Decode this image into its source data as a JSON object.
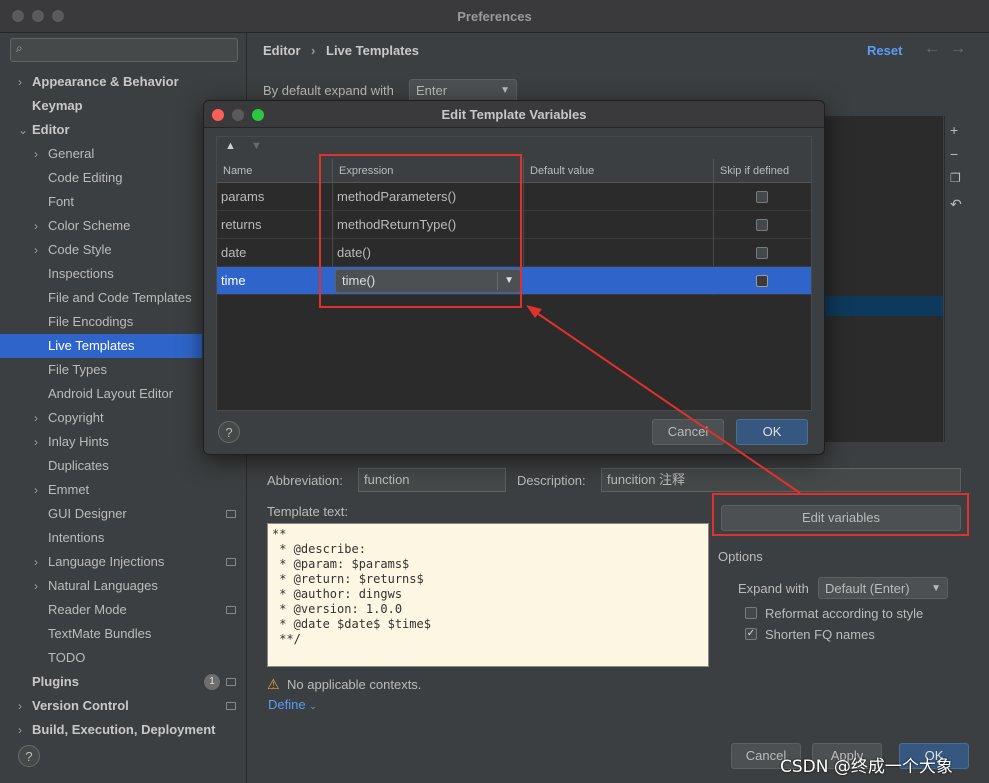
{
  "window": {
    "title": "Preferences"
  },
  "search": {
    "placeholder": ""
  },
  "sidebar": {
    "items": [
      {
        "label": "Appearance & Behavior",
        "arrow": "›",
        "bold": true
      },
      {
        "label": "Keymap",
        "arrow": "",
        "bold": true
      },
      {
        "label": "Editor",
        "arrow": "⌄",
        "bold": true
      },
      {
        "label": "General",
        "arrow": "›"
      },
      {
        "label": "Code Editing",
        "arrow": ""
      },
      {
        "label": "Font",
        "arrow": ""
      },
      {
        "label": "Color Scheme",
        "arrow": "›"
      },
      {
        "label": "Code Style",
        "arrow": "›"
      },
      {
        "label": "Inspections",
        "arrow": ""
      },
      {
        "label": "File and Code Templates",
        "arrow": ""
      },
      {
        "label": "File Encodings",
        "arrow": ""
      },
      {
        "label": "Live Templates",
        "arrow": "",
        "selected": true
      },
      {
        "label": "File Types",
        "arrow": ""
      },
      {
        "label": "Android Layout Editor",
        "arrow": ""
      },
      {
        "label": "Copyright",
        "arrow": "›"
      },
      {
        "label": "Inlay Hints",
        "arrow": "›"
      },
      {
        "label": "Duplicates",
        "arrow": ""
      },
      {
        "label": "Emmet",
        "arrow": "›"
      },
      {
        "label": "GUI Designer",
        "arrow": ""
      },
      {
        "label": "Intentions",
        "arrow": ""
      },
      {
        "label": "Language Injections",
        "arrow": "›"
      },
      {
        "label": "Natural Languages",
        "arrow": "›"
      },
      {
        "label": "Reader Mode",
        "arrow": ""
      },
      {
        "label": "TextMate Bundles",
        "arrow": ""
      },
      {
        "label": "TODO",
        "arrow": ""
      },
      {
        "label": "Plugins",
        "arrow": "",
        "bold": true,
        "badge": "1"
      },
      {
        "label": "Version Control",
        "arrow": "›",
        "bold": true
      },
      {
        "label": "Build, Execution, Deployment",
        "arrow": "›",
        "bold": true
      }
    ]
  },
  "breadcrumb": {
    "parent": "Editor",
    "separator": "›",
    "current": "Live Templates"
  },
  "header": {
    "reset_label": "Reset",
    "back_glyph": "←",
    "forward_glyph": "→"
  },
  "expand_default": {
    "label": "By default expand with",
    "value": "Enter"
  },
  "dialog": {
    "title": "Edit Template Variables",
    "columns": [
      "Name",
      "Expression",
      "Default value",
      "Skip if defined"
    ],
    "rows": [
      {
        "name": "params",
        "expression": "methodParameters()",
        "default": "",
        "skip": false
      },
      {
        "name": "returns",
        "expression": "methodReturnType()",
        "default": "",
        "skip": false
      },
      {
        "name": "date",
        "expression": "date()",
        "default": "",
        "skip": false
      },
      {
        "name": "time",
        "expression": "time()",
        "default": "",
        "skip": false,
        "selected": true
      }
    ],
    "cancel_label": "Cancel",
    "ok_label": "OK",
    "help_glyph": "?"
  },
  "abbreviation": {
    "label": "Abbreviation:",
    "value": "function"
  },
  "description": {
    "label": "Description:",
    "value": "funcition 注释"
  },
  "edit_variables_label": "Edit variables",
  "template_text": {
    "label": "Template text:",
    "value": "**\n * @describe:\n * @param: $params$\n * @return: $returns$\n * @author: dingws\n * @version: 1.0.0\n * @date $date$ $time$\n **/"
  },
  "options": {
    "title": "Options",
    "expand_label": "Expand with",
    "expand_value": "Default (Enter)",
    "reformat_label": "Reformat according to style",
    "reformat_checked": false,
    "shorten_label": "Shorten FQ names",
    "shorten_checked": true
  },
  "warning": {
    "text": "No applicable contexts.",
    "define_label": "Define"
  },
  "footer": {
    "cancel_label": "Cancel",
    "apply_label": "Apply",
    "ok_label": "OK",
    "help_glyph": "?"
  },
  "watermark": "CSDN @终成一个大象",
  "colors": {
    "selection": "#2f65ca",
    "link": "#589df6",
    "annotation": "#e0312c"
  }
}
